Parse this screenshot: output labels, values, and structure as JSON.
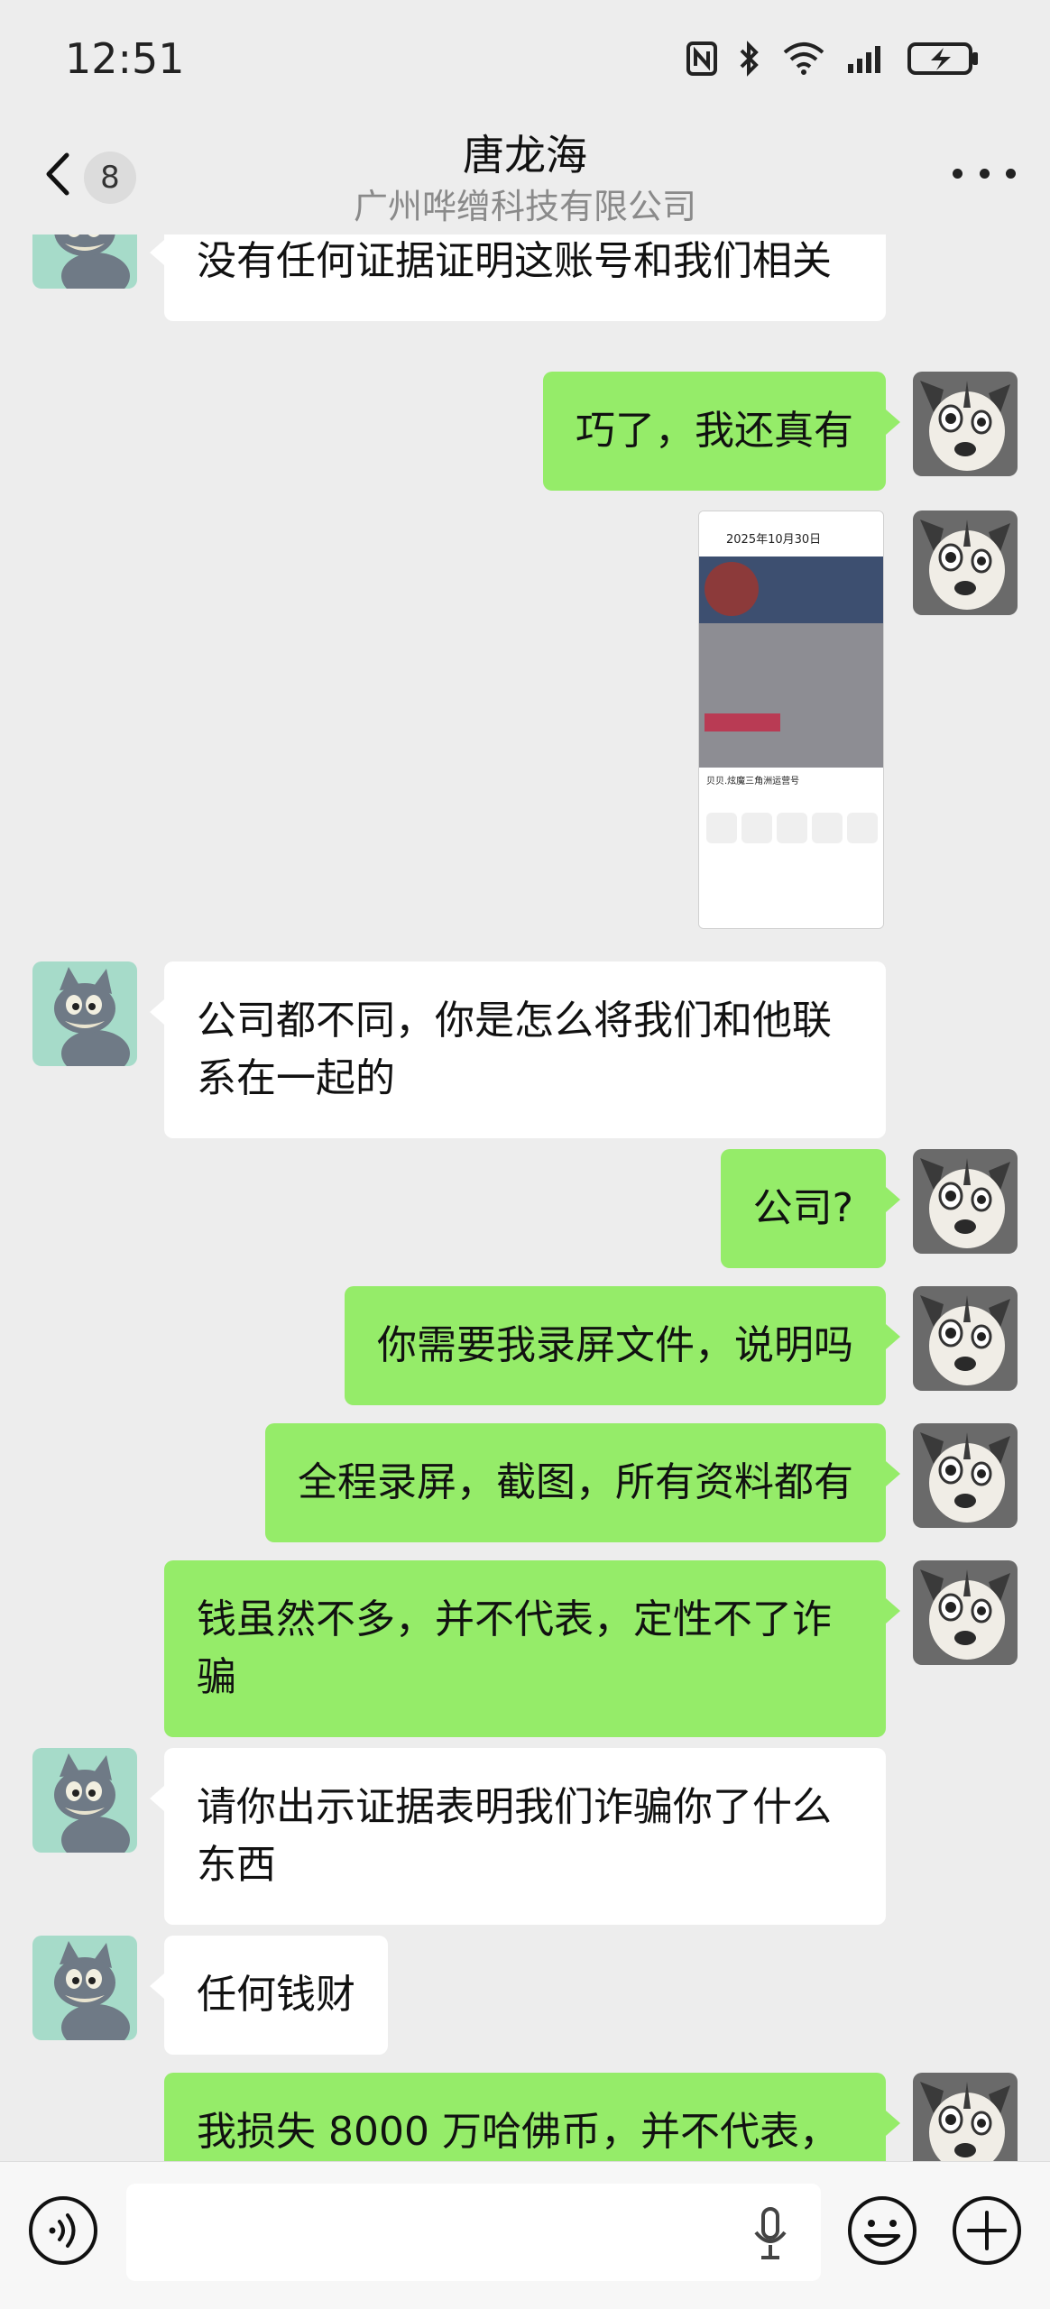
{
  "status_bar": {
    "time": "12:51",
    "icons": [
      "nfc-icon",
      "bluetooth-icon",
      "wifi-icon",
      "signal-icon",
      "battery-charging-icon"
    ]
  },
  "header": {
    "back_icon": "chevron-left-icon",
    "unread_count": "8",
    "title": "唐龙海",
    "subtitle": "广州哗缯科技有限公司",
    "more_icon": "more-dots-icon"
  },
  "messages": [
    {
      "side": "in",
      "text": "没有任何证据证明这账号和我们相关",
      "avatar": "cat-avatar"
    },
    {
      "side": "out",
      "text": "巧了，我还真有",
      "avatar": "dog-avatar"
    },
    {
      "side": "out",
      "type": "image",
      "avatar": "dog-avatar",
      "image_text": {
        "date": "2025年10月30日",
        "sheet_title": "贝贝.炫魔三角洲运营号"
      }
    },
    {
      "side": "in",
      "text": "公司都不同，你是怎么将我们和他联系在一起的",
      "avatar": "cat-avatar"
    },
    {
      "side": "out",
      "text": "公司?",
      "avatar": "dog-avatar"
    },
    {
      "side": "out",
      "text": "你需要我录屏文件，说明吗",
      "avatar": "dog-avatar"
    },
    {
      "side": "out",
      "text": "全程录屏，截图，所有资料都有",
      "avatar": "dog-avatar"
    },
    {
      "side": "out",
      "text": "钱虽然不多，并不代表，定性不了诈骗",
      "avatar": "dog-avatar"
    },
    {
      "side": "in",
      "text": "请你出示证据表明我们诈骗你了什么东西",
      "avatar": "cat-avatar"
    },
    {
      "side": "in",
      "text": "任何钱财",
      "avatar": "cat-avatar"
    },
    {
      "side": "out",
      "text": "我损失 8000 万哈佛币，并不代表，",
      "avatar": "dog-avatar"
    }
  ],
  "input_bar": {
    "voice_icon": "voice-icon",
    "text_value": "",
    "mic_icon": "microphone-icon",
    "emoji_icon": "emoji-icon",
    "plus_icon": "plus-icon"
  },
  "colors": {
    "background": "#ededed",
    "outgoing_bubble": "#95ec69",
    "incoming_bubble": "#ffffff"
  }
}
